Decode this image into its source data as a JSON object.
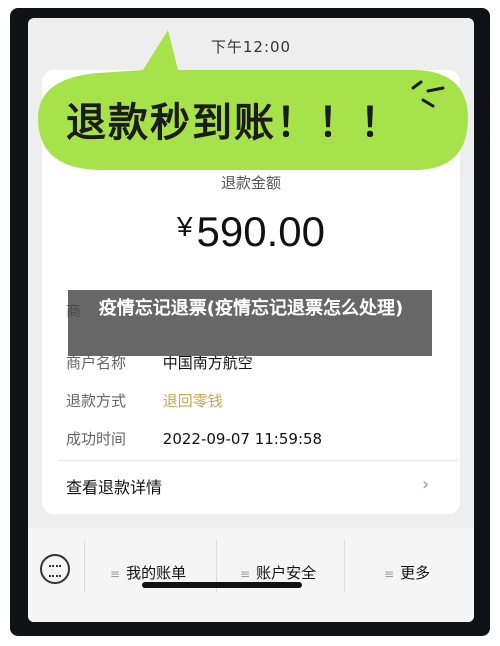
{
  "status": {
    "time": "下午12:00"
  },
  "promo": {
    "bubble_text": "退款秒到账！！！",
    "bubble_color": "#a6e34a"
  },
  "refund": {
    "amount_label": "退款金额",
    "currency": "¥",
    "amount": "590.00",
    "rows": [
      {
        "key": "商户名称",
        "value": "中国南方航空"
      },
      {
        "key": "退款方式",
        "value": "退回零钱"
      },
      {
        "key": "成功时间",
        "value": "2022-09-07 11:59:58"
      }
    ],
    "detail_link": "查看退款详情",
    "truncated_key": "商"
  },
  "bottom_bar": {
    "tabs": [
      "我的账单",
      "账户安全",
      "更多"
    ]
  },
  "overlay": {
    "title": "疫情忘记退票(疫情忘记退票怎么处理)"
  },
  "colors": {
    "accent_gold": "#c9a650"
  }
}
